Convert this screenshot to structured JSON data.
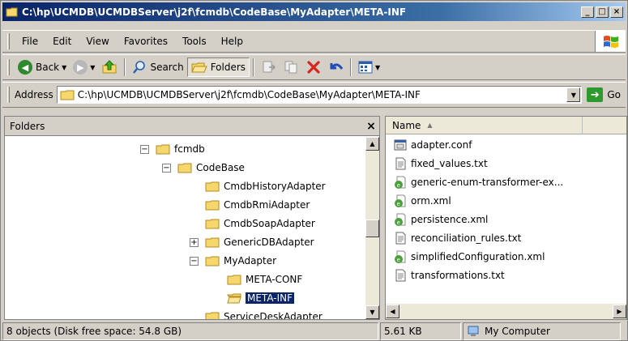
{
  "window": {
    "title": "C:\\hp\\UCMDB\\UCMDBServer\\j2f\\fcmdb\\CodeBase\\MyAdapter\\META-INF",
    "minimize": "_",
    "maximize": "□",
    "close": "×"
  },
  "menu": [
    "File",
    "Edit",
    "View",
    "Favorites",
    "Tools",
    "Help"
  ],
  "toolbar": {
    "back_label": "Back",
    "search_label": "Search",
    "folders_label": "Folders"
  },
  "address": {
    "label": "Address",
    "value": "C:\\hp\\UCMDB\\UCMDBServer\\j2f\\fcmdb\\CodeBase\\MyAdapter\\META-INF",
    "go_label": "Go"
  },
  "folders_pane": {
    "title": "Folders",
    "close": "×",
    "nodes": [
      {
        "label": "fcmdb",
        "toggle": "−"
      },
      {
        "label": "CodeBase",
        "toggle": "−"
      },
      {
        "label": "CmdbHistoryAdapter",
        "toggle": ""
      },
      {
        "label": "CmdbRmiAdapter",
        "toggle": ""
      },
      {
        "label": "CmdbSoapAdapter",
        "toggle": ""
      },
      {
        "label": "GenericDBAdapter",
        "toggle": "+"
      },
      {
        "label": "MyAdapter",
        "toggle": "−"
      },
      {
        "label": "META-CONF",
        "toggle": ""
      },
      {
        "label": "META-INF",
        "toggle": ""
      },
      {
        "label": "ServiceDeskAdapter",
        "toggle": ""
      }
    ]
  },
  "files_pane": {
    "column_name": "Name",
    "files": [
      {
        "name": "adapter.conf",
        "icon": "config-file-icon"
      },
      {
        "name": "fixed_values.txt",
        "icon": "text-file-icon"
      },
      {
        "name": "generic-enum-transformer-ex...",
        "icon": "xml-file-icon"
      },
      {
        "name": "orm.xml",
        "icon": "xml-file-icon"
      },
      {
        "name": "persistence.xml",
        "icon": "xml-file-icon"
      },
      {
        "name": "reconciliation_rules.txt",
        "icon": "text-file-icon"
      },
      {
        "name": "simplifiedConfiguration.xml",
        "icon": "xml-file-icon"
      },
      {
        "name": "transformations.txt",
        "icon": "text-file-icon"
      }
    ]
  },
  "status": {
    "objects": "8 objects (Disk free space: 54.8 GB)",
    "size": "5.61 KB",
    "zone": "My Computer"
  }
}
